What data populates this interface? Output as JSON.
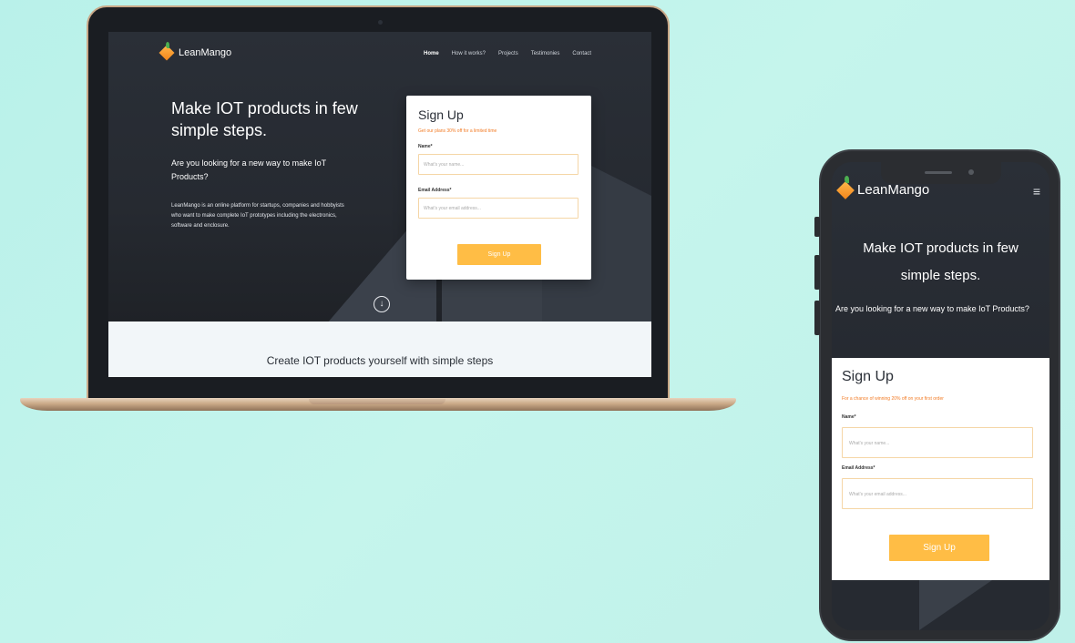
{
  "laptop": {
    "logo_text": "LeanMango",
    "nav": [
      "Home",
      "How it works?",
      "Projects",
      "Testimonies",
      "Contact"
    ],
    "hero": {
      "title": "Make IOT products in few simple steps.",
      "question": "Are you looking for a new way to make IoT Products?",
      "description": "LeanMango is an online platform for startups, companies and hobbyists who want to make complete IoT prototypes including the electronics, software and enclosure."
    },
    "form": {
      "title": "Sign Up",
      "subtitle": "Get our plans 30% off for a limited time",
      "name_label": "Name*",
      "name_placeholder": "What's your name...",
      "email_label": "Email Address*",
      "email_placeholder": "What's your email address...",
      "button": "Sign Up"
    },
    "scroll_icon": "arrow-down-circle-icon",
    "section_title": "Create IOT products yourself with simple steps"
  },
  "phone": {
    "logo_text": "LeanMango",
    "menu_icon": "≡",
    "hero": {
      "title": "Make IOT products in few simple steps.",
      "question": "Are you looking for a new way to make IoT Products?"
    },
    "form": {
      "title": "Sign Up",
      "subtitle": "For a chance of winning 20% off on your first order",
      "name_label": "Name*",
      "name_placeholder": "What's your name...",
      "email_label": "Email Address*",
      "email_placeholder": "What's your email address...",
      "button": "Sign Up"
    }
  },
  "colors": {
    "accent": "#ffbd45",
    "subtitle": "#f27b25",
    "hero_bg": "#2a2f37",
    "background": "#c1f3eb"
  }
}
